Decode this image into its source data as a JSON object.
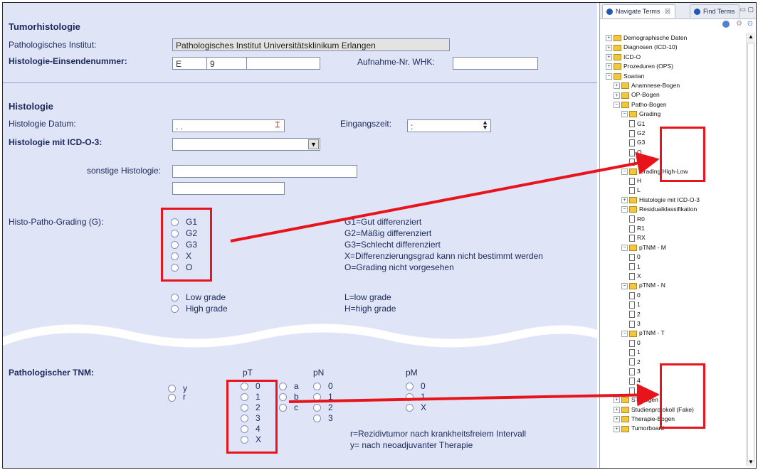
{
  "tumor": {
    "title": "Tumorhistologie",
    "institute_label": "Pathologisches Institut:",
    "institute_value": "Pathologisches Institut Universitätsklinikum Erlangen",
    "einsendenummer_label": "Histologie-Einsendenummer:",
    "einsende_part1": "E",
    "einsende_part2": "9",
    "einsende_part3": "",
    "aufnahme_label": "Aufnahme-Nr. WHK:",
    "aufnahme_value": ""
  },
  "histologie": {
    "title": "Histologie",
    "datum_label": "Histologie Datum:",
    "datum_value": ". .",
    "eingangszeit_label": "Eingangszeit:",
    "eingangszeit_value": ":",
    "icd_label": "Histologie mit ICD-O-3:",
    "icd_value": "",
    "sonstige_label": "sonstige Histologie:",
    "sonstige_value1": "",
    "sonstige_value2": ""
  },
  "grading": {
    "label": "Histo-Patho-Grading (G):",
    "options": [
      "G1",
      "G2",
      "G3",
      "X",
      "O"
    ],
    "legend": [
      "G1=Gut differenziert",
      "G2=Mäßig differenziert",
      "G3=Schlecht differenziert",
      "X=Differenzierungsgrad kann nicht bestimmt werden",
      "O=Grading nicht vorgesehen"
    ],
    "lowhigh_options": [
      "Low grade",
      "High grade"
    ],
    "lowhigh_legend": [
      "L=low grade",
      "H=high grade"
    ]
  },
  "tnm": {
    "label": "Pathologischer TNM:",
    "pt_header": "pT",
    "pn_header": "pN",
    "pm_header": "pM",
    "prefix_options": [
      "y",
      "r"
    ],
    "pt_options": [
      "0",
      "1",
      "2",
      "3",
      "4",
      "X"
    ],
    "suffix_options": [
      "a",
      "b",
      "c"
    ],
    "pn_options": [
      "0",
      "1",
      "2",
      "3"
    ],
    "pm_options": [
      "0",
      "1",
      "X"
    ],
    "legend": [
      "r=Rezidivtumor nach krankheitsfreiem Intervall",
      "y= nach neoadjuvanter Therapie"
    ]
  },
  "panel": {
    "tab_navigate": "Navigate Terms",
    "tab_close": "☒",
    "tab_find": "Find Terms",
    "tree": [
      {
        "label": "Demographische Daten",
        "level": 0,
        "kind": "folder",
        "exp": "+"
      },
      {
        "label": "Diagnosen (ICD-10)",
        "level": 0,
        "kind": "folder",
        "exp": "+"
      },
      {
        "label": "ICD-O",
        "level": 0,
        "kind": "folder",
        "exp": "+"
      },
      {
        "label": "Prozeduren (OPS)",
        "level": 0,
        "kind": "folder",
        "exp": "+"
      },
      {
        "label": "Soarian",
        "level": 0,
        "kind": "folder",
        "exp": "−"
      },
      {
        "label": "Anamnese-Bogen",
        "level": 1,
        "kind": "folder",
        "exp": "+"
      },
      {
        "label": "OP-Bogen",
        "level": 1,
        "kind": "folder",
        "exp": "+"
      },
      {
        "label": "Patho-Bogen",
        "level": 1,
        "kind": "folder",
        "exp": "−"
      },
      {
        "label": "Grading",
        "level": 2,
        "kind": "folder",
        "exp": "−"
      },
      {
        "label": "G1",
        "level": 3,
        "kind": "doc"
      },
      {
        "label": "G2",
        "level": 3,
        "kind": "doc"
      },
      {
        "label": "G3",
        "level": 3,
        "kind": "doc"
      },
      {
        "label": "O",
        "level": 3,
        "kind": "doc"
      },
      {
        "label": "X",
        "level": 3,
        "kind": "doc"
      },
      {
        "label": "Grading High-Low",
        "level": 2,
        "kind": "folder",
        "exp": "−"
      },
      {
        "label": "H",
        "level": 3,
        "kind": "doc"
      },
      {
        "label": "L",
        "level": 3,
        "kind": "doc"
      },
      {
        "label": "Histologie mit ICD-O-3",
        "level": 2,
        "kind": "folder",
        "exp": "+"
      },
      {
        "label": "Residualklassifikation",
        "level": 2,
        "kind": "folder",
        "exp": "−"
      },
      {
        "label": "R0",
        "level": 3,
        "kind": "doc"
      },
      {
        "label": "R1",
        "level": 3,
        "kind": "doc"
      },
      {
        "label": "RX",
        "level": 3,
        "kind": "doc"
      },
      {
        "label": "pTNM - M",
        "level": 2,
        "kind": "folder",
        "exp": "−"
      },
      {
        "label": "0",
        "level": 3,
        "kind": "doc"
      },
      {
        "label": "1",
        "level": 3,
        "kind": "doc"
      },
      {
        "label": "X",
        "level": 3,
        "kind": "doc"
      },
      {
        "label": "pTNM - N",
        "level": 2,
        "kind": "folder",
        "exp": "−"
      },
      {
        "label": "0",
        "level": 3,
        "kind": "doc"
      },
      {
        "label": "1",
        "level": 3,
        "kind": "doc"
      },
      {
        "label": "2",
        "level": 3,
        "kind": "doc"
      },
      {
        "label": "3",
        "level": 3,
        "kind": "doc"
      },
      {
        "label": "pTNM - T",
        "level": 2,
        "kind": "folder",
        "exp": "−"
      },
      {
        "label": "0",
        "level": 3,
        "kind": "doc"
      },
      {
        "label": "1",
        "level": 3,
        "kind": "doc"
      },
      {
        "label": "2",
        "level": 3,
        "kind": "doc"
      },
      {
        "label": "3",
        "level": 3,
        "kind": "doc"
      },
      {
        "label": "4",
        "level": 3,
        "kind": "doc"
      },
      {
        "label": "X",
        "level": 3,
        "kind": "doc"
      },
      {
        "label": "ST-Bogen",
        "level": 1,
        "kind": "folder",
        "exp": "+"
      },
      {
        "label": "Studienprotokoll (Fake)",
        "level": 1,
        "kind": "folder",
        "exp": "+"
      },
      {
        "label": "Therapie-Bogen",
        "level": 1,
        "kind": "folder",
        "exp": "+"
      },
      {
        "label": "Tumorboard",
        "level": 1,
        "kind": "folder",
        "exp": "+"
      }
    ]
  },
  "colors": {
    "form_bg": "#dfe4f6",
    "label_text": "#1b2a5a",
    "highlight_red": "#e8141c",
    "folder_yellow": "#f3c73d"
  }
}
